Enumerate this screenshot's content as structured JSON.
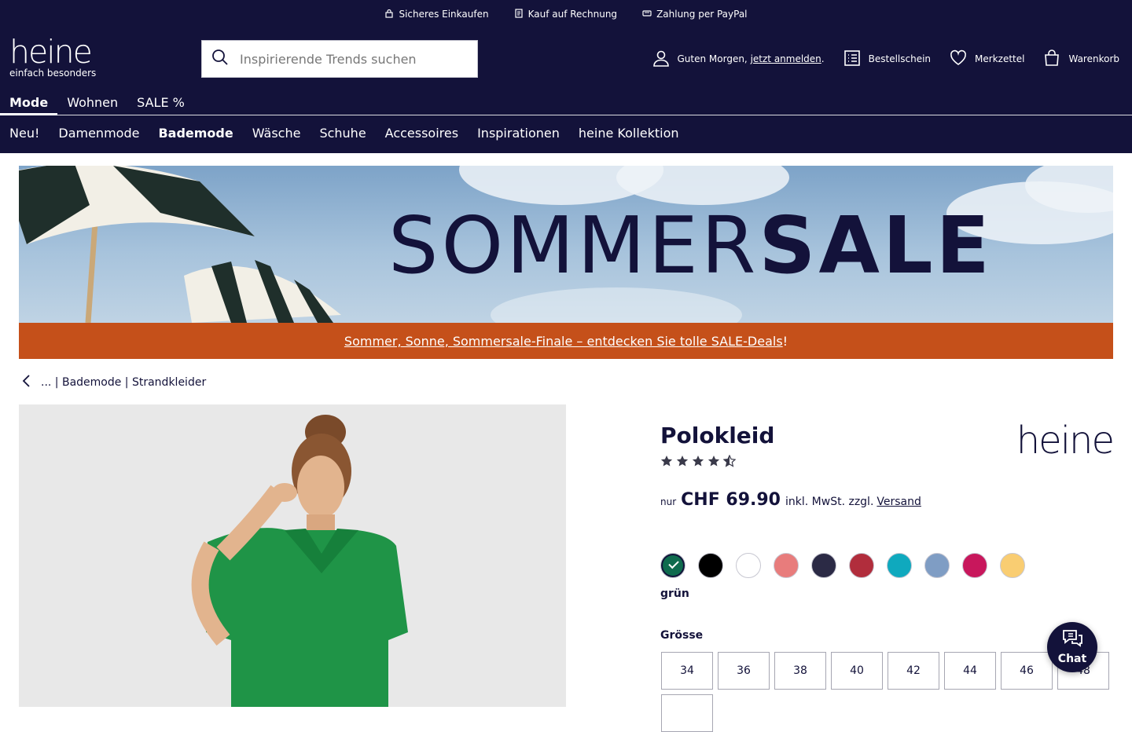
{
  "usp": [
    {
      "icon": "lock-icon",
      "label": "Sicheres Einkaufen"
    },
    {
      "icon": "invoice-icon",
      "label": "Kauf auf Rechnung"
    },
    {
      "icon": "paypal-icon",
      "label": "Zahlung per PayPal"
    }
  ],
  "logo": {
    "word": "heine",
    "tagline": "einfach besonders"
  },
  "search": {
    "placeholder": "Inspirierende Trends suchen"
  },
  "account": {
    "greeting": "Guten Morgen, ",
    "login_link": "jetzt anmelden",
    "greeting_suffix": ".",
    "order_form": "Bestellschein",
    "wishlist": "Merkzettel",
    "cart": "Warenkorb"
  },
  "main_tabs": [
    {
      "label": "Mode",
      "active": true
    },
    {
      "label": "Wohnen",
      "active": false
    },
    {
      "label": "SALE %",
      "active": false
    }
  ],
  "categories": [
    {
      "label": "Neu!",
      "active": false
    },
    {
      "label": "Damenmode",
      "active": false
    },
    {
      "label": "Bademode",
      "active": true
    },
    {
      "label": "Wäsche",
      "active": false
    },
    {
      "label": "Schuhe",
      "active": false
    },
    {
      "label": "Accessoires",
      "active": false
    },
    {
      "label": "Inspirationen",
      "active": false
    },
    {
      "label": "heine Kollektion",
      "active": false
    }
  ],
  "banner": {
    "title_light": "SOMMER",
    "title_bold": "SALE"
  },
  "sale_line": {
    "link": "Sommer, Sonne, Sommersale-Finale – entdecken Sie tolle SALE-Deals",
    "suffix": "!"
  },
  "breadcrumb": {
    "text": "... | Bademode | Strandkleider"
  },
  "product": {
    "title": "Polokleid",
    "brand": "heine",
    "rating": 4.5,
    "price_prefix": "nur",
    "price": "CHF 69.90",
    "price_suffix": "inkl. MwSt. zzgl.",
    "shipping_link": "Versand",
    "colors": [
      {
        "hex": "#0f6b4e",
        "selected": true
      },
      {
        "hex": "#000000",
        "selected": false
      },
      {
        "hex": "#ffffff",
        "selected": false
      },
      {
        "hex": "#e87c7c",
        "selected": false
      },
      {
        "hex": "#2b2a45",
        "selected": false
      },
      {
        "hex": "#b12d3c",
        "selected": false
      },
      {
        "hex": "#0fa9be",
        "selected": false
      },
      {
        "hex": "#7f9dc4",
        "selected": false
      },
      {
        "hex": "#c8175c",
        "selected": false
      },
      {
        "hex": "#f9cd72",
        "selected": false
      }
    ],
    "selected_color_name": "grün",
    "size_label": "Grösse",
    "sizes": [
      "34",
      "36",
      "38",
      "40",
      "42",
      "44",
      "46",
      "48",
      ""
    ]
  },
  "chat": {
    "label": "Chat"
  },
  "colors": {
    "navy": "#13123a",
    "sale_orange": "#c5501a"
  }
}
